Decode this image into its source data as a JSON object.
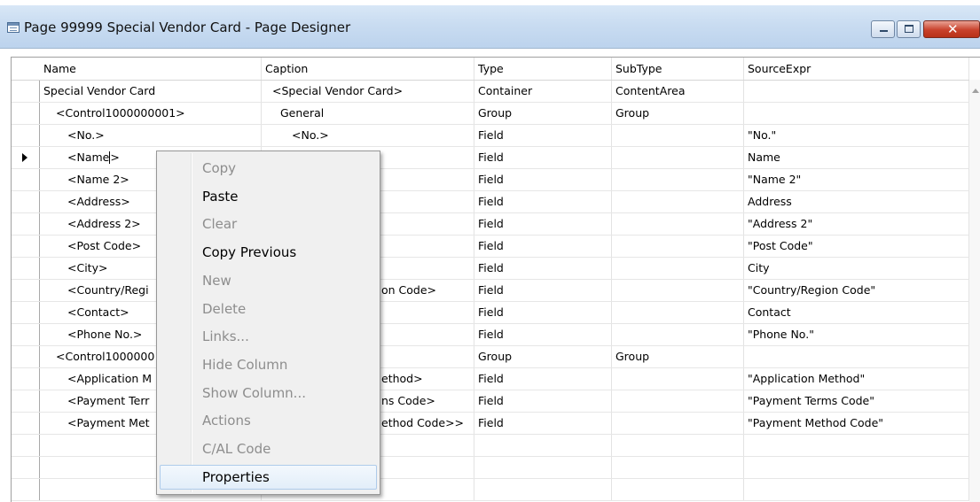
{
  "window": {
    "title": "Page 99999 Special Vendor Card - Page Designer",
    "close_glyph": "✕"
  },
  "columns": [
    "Name",
    "Caption",
    "Type",
    "SubType",
    "SourceExpr"
  ],
  "rows": [
    {
      "name": "Special Vendor Card",
      "caption": "<Special Vendor Card>",
      "type": "Container",
      "subtype": "ContentArea",
      "source": ""
    },
    {
      "name": "<Control1000000001>",
      "caption": "General",
      "type": "Group",
      "subtype": "Group",
      "source": ""
    },
    {
      "name": "<No.>",
      "caption": "<No.>",
      "type": "Field",
      "subtype": "",
      "source": "\"No.\""
    },
    {
      "name_before_cursor": "<Name",
      "name_after_cursor": ">",
      "caption": "",
      "type": "Field",
      "subtype": "",
      "source": "Name"
    },
    {
      "name": "<Name 2>",
      "caption": "",
      "type": "Field",
      "subtype": "",
      "source": "\"Name 2\""
    },
    {
      "name": "<Address>",
      "caption": "",
      "type": "Field",
      "subtype": "",
      "source": "Address"
    },
    {
      "name": "<Address 2>",
      "caption": "",
      "type": "Field",
      "subtype": "",
      "source": "\"Address 2\""
    },
    {
      "name": "<Post Code>",
      "caption": "",
      "type": "Field",
      "subtype": "",
      "source": "\"Post Code\""
    },
    {
      "name": "<City>",
      "caption": "",
      "type": "Field",
      "subtype": "",
      "source": "City"
    },
    {
      "name": "<Country/Regi",
      "caption": "on Code>",
      "type": "Field",
      "subtype": "",
      "source": "\"Country/Region Code\""
    },
    {
      "name": "<Contact>",
      "caption": "",
      "type": "Field",
      "subtype": "",
      "source": "Contact"
    },
    {
      "name": "<Phone No.>",
      "caption": "",
      "type": "Field",
      "subtype": "",
      "source": "\"Phone No.\""
    },
    {
      "name": "<Control1000000",
      "caption": "",
      "type": "Group",
      "subtype": "Group",
      "source": ""
    },
    {
      "name": "<Application M",
      "caption": "ethod>",
      "type": "Field",
      "subtype": "",
      "source": "\"Application Method\""
    },
    {
      "name": "<Payment Terr",
      "caption": "ns Code>",
      "type": "Field",
      "subtype": "",
      "source": "\"Payment Terms Code\""
    },
    {
      "name": "<Payment Met",
      "caption": "ethod Code>>",
      "type": "Field",
      "subtype": "",
      "source": "\"Payment Method Code\""
    }
  ],
  "context_menu": {
    "items": [
      {
        "label": "Copy",
        "enabled": false
      },
      {
        "label": "Paste",
        "enabled": true
      },
      {
        "label": "Clear",
        "enabled": false
      },
      {
        "label": "Copy Previous",
        "enabled": true
      },
      {
        "label": "New",
        "enabled": false
      },
      {
        "label": "Delete",
        "enabled": false
      },
      {
        "label": "Links...",
        "enabled": false
      },
      {
        "label": "Hide Column",
        "enabled": false
      },
      {
        "label": "Show Column...",
        "enabled": false
      },
      {
        "label": "Actions",
        "enabled": false
      },
      {
        "label": "C/AL Code",
        "enabled": false
      },
      {
        "label": "Properties",
        "enabled": true,
        "highlighted": true
      }
    ]
  }
}
